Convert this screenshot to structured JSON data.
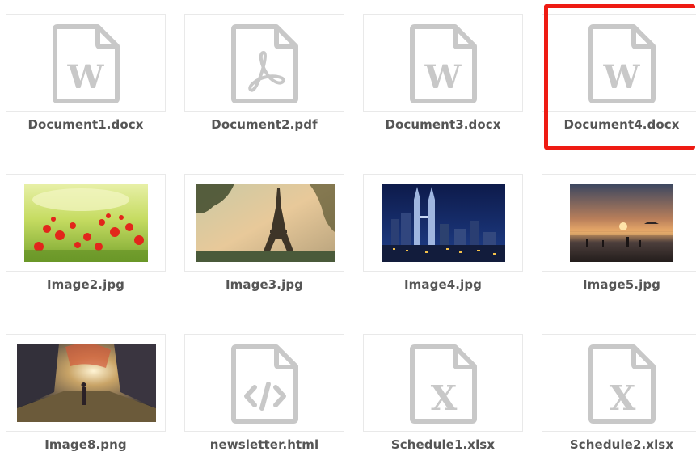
{
  "selected_file": "Document4.docx",
  "colors": {
    "selection": "#ee1b13",
    "icon_gray": "#c8c8c8",
    "label_text": "#555555"
  },
  "files": [
    {
      "name": "Document1.docx",
      "kind": "word-file-icon"
    },
    {
      "name": "Document2.pdf",
      "kind": "pdf-file-icon"
    },
    {
      "name": "Document3.docx",
      "kind": "word-file-icon"
    },
    {
      "name": "Document4.docx",
      "kind": "word-file-icon"
    },
    {
      "name": "Image2.jpg",
      "kind": "image-thumbnail-poppy-field"
    },
    {
      "name": "Image3.jpg",
      "kind": "image-thumbnail-eiffel-tower"
    },
    {
      "name": "Image4.jpg",
      "kind": "image-thumbnail-city-night"
    },
    {
      "name": "Image5.jpg",
      "kind": "image-thumbnail-beach-sunset"
    },
    {
      "name": "Image8.png",
      "kind": "image-thumbnail-fantasy-street"
    },
    {
      "name": "newsletter.html",
      "kind": "html-file-icon"
    },
    {
      "name": "Schedule1.xlsx",
      "kind": "excel-file-icon"
    },
    {
      "name": "Schedule2.xlsx",
      "kind": "excel-file-icon"
    }
  ]
}
